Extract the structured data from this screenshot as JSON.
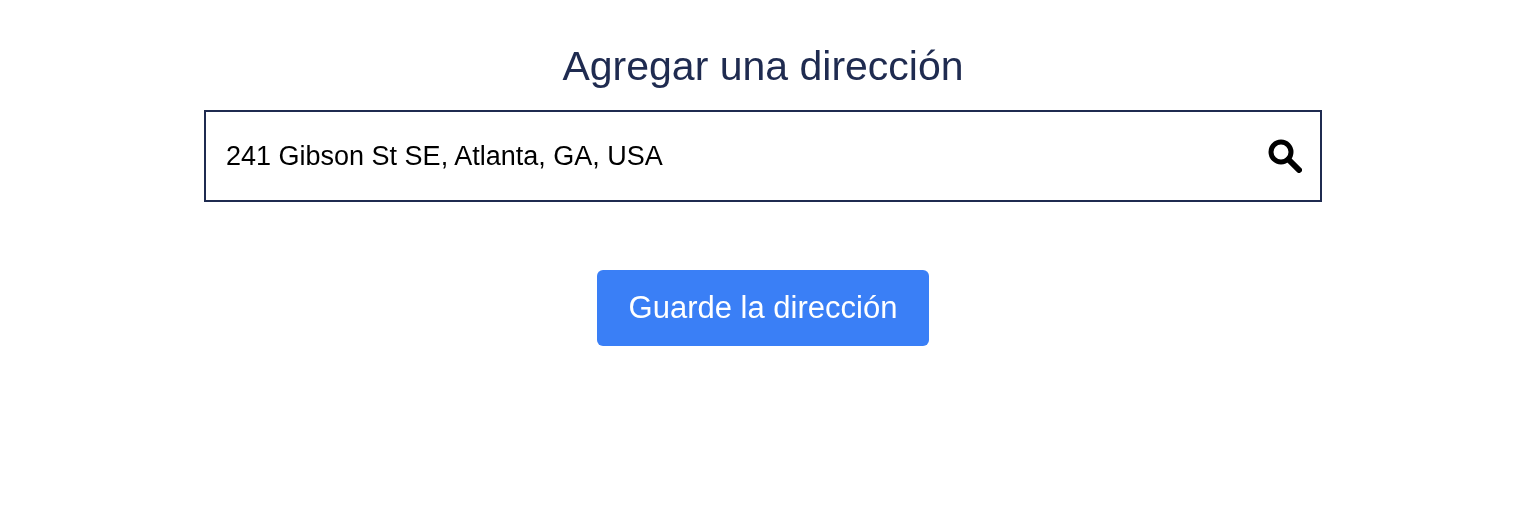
{
  "heading": "Agregar una dirección",
  "address_field": {
    "value": "241 Gibson St SE, Atlanta, GA, USA"
  },
  "save_button": {
    "label": "Guarde la dirección"
  }
}
